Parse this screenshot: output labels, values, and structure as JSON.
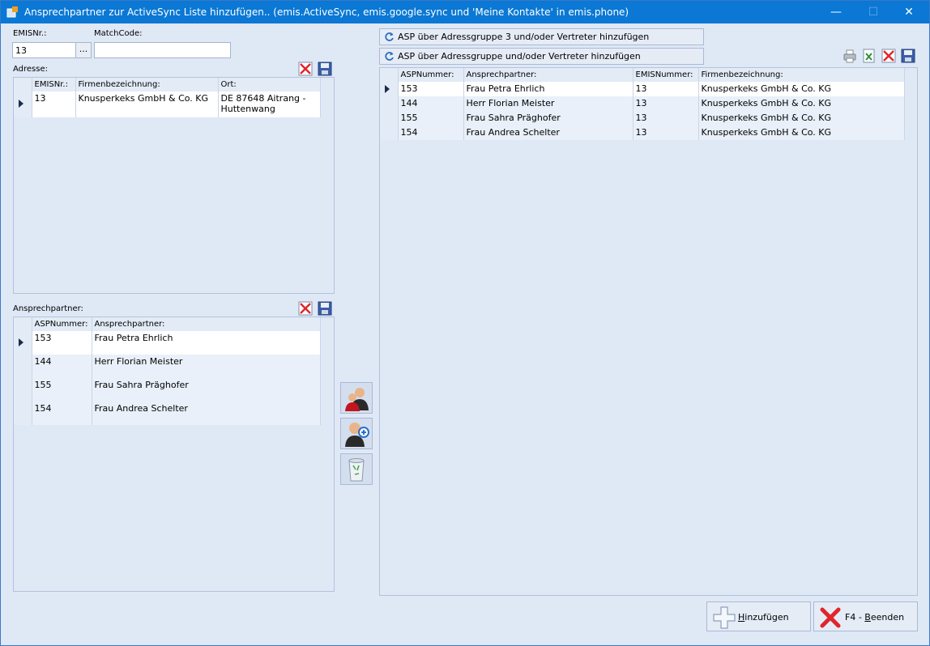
{
  "window": {
    "title": "Ansprechpartner zur ActiveSync Liste hinzufügen.. (emis.ActiveSync, emis.google.sync und 'Meine Kontakte' in emis.phone)",
    "controls": [
      "minimize-icon",
      "maximize-icon",
      "close-icon"
    ]
  },
  "filters": {
    "emisnr_label": "EMISNr.:",
    "emisnr_value": "13",
    "lookup_button": "...",
    "matchcode_label": "MatchCode:",
    "matchcode_value": ""
  },
  "address": {
    "label": "Adresse:",
    "columns": [
      "EMISNr.:",
      "Firmenbezeichnung:",
      "Ort:"
    ],
    "rows": [
      {
        "emisnr": "13",
        "firma": "Knusperkeks GmbH & Co. KG",
        "ort": "DE 87648 Aitrang - Huttenwang"
      }
    ]
  },
  "contacts": {
    "label": "Ansprechpartner:",
    "columns": [
      "ASPNummer:",
      "Ansprechpartner:"
    ],
    "rows": [
      {
        "nr": "153",
        "name": "Frau Petra Ehrlich"
      },
      {
        "nr": "144",
        "name": "Herr Florian Meister"
      },
      {
        "nr": "155",
        "name": "Frau Sahra Präghofer"
      },
      {
        "nr": "154",
        "name": "Frau Andrea Schelter"
      }
    ]
  },
  "toolbar": {
    "group3_button": "ASP über Adressgruppe 3 und/oder Vertreter hinzufügen",
    "group_button": "ASP über Adressgruppe und/oder Vertreter hinzufügen"
  },
  "activesync": {
    "columns": [
      "ASPNummer:",
      "Ansprechpartner:",
      "EMISNummer:",
      "Firmenbezeichnung:"
    ],
    "rows": [
      {
        "nr": "153",
        "name": "Frau Petra Ehrlich",
        "emis": "13",
        "firma": "Knusperkeks GmbH & Co. KG"
      },
      {
        "nr": "144",
        "name": "Herr Florian Meister",
        "emis": "13",
        "firma": "Knusperkeks GmbH & Co. KG"
      },
      {
        "nr": "155",
        "name": "Frau Sahra Präghofer",
        "emis": "13",
        "firma": "Knusperkeks GmbH & Co. KG"
      },
      {
        "nr": "154",
        "name": "Frau Andrea Schelter",
        "emis": "13",
        "firma": "Knusperkeks GmbH & Co. KG"
      }
    ]
  },
  "footer": {
    "add_prefix": "H",
    "add_rest": "inzufügen",
    "quit_prefix": "F4 - ",
    "quit_underline": "B",
    "quit_rest": "eenden"
  },
  "colors": {
    "titlebar": "#0a78d4",
    "window_bg": "#dfe8f5",
    "delete_red": "#e0252b",
    "save_blue": "#3a5ea8"
  }
}
